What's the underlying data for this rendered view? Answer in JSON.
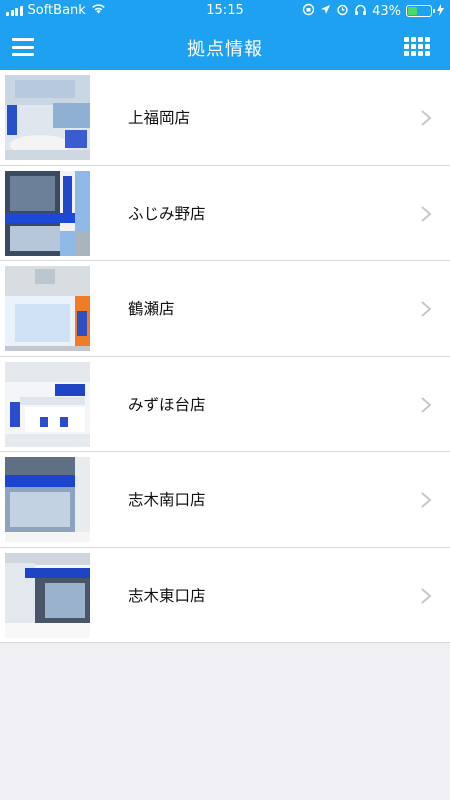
{
  "status_bar": {
    "carrier": "SoftBank",
    "time": "15:15",
    "battery_text": "43%",
    "battery_level": 0.43,
    "icons": [
      "signal-icon",
      "wifi-icon",
      "orientation-lock-icon",
      "location-icon",
      "alarm-icon",
      "headphones-icon",
      "battery-icon",
      "charging-icon"
    ]
  },
  "header": {
    "title": "拠点情報",
    "menu_icon": "hamburger-menu-icon",
    "grid_icon": "grid-menu-icon",
    "accent_color": "#1ea1f1"
  },
  "stores": [
    {
      "name": "上福岡店",
      "photo": "store-interior-photo"
    },
    {
      "name": "ふじみ野店",
      "photo": "store-building-photo"
    },
    {
      "name": "鶴瀬店",
      "photo": "store-front-photo"
    },
    {
      "name": "みずほ台店",
      "photo": "store-interior-photo"
    },
    {
      "name": "志木南口店",
      "photo": "store-front-photo"
    },
    {
      "name": "志木東口店",
      "photo": "store-street-photo"
    }
  ]
}
